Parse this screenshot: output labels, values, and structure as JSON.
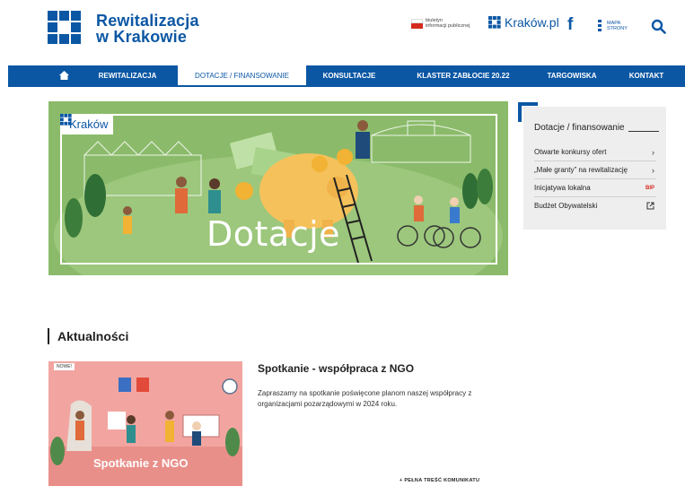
{
  "header": {
    "logo_line1": "Rewitalizacja",
    "logo_line2": "w Krakowie",
    "bip_line1": "biuletyn",
    "bip_line2": "informacji publicznej",
    "krakow_pl": "Kraków.pl",
    "facebook": "f",
    "map_line1": "MAPA",
    "map_line2": "STRONY",
    "icons": [
      "krakow-logo-icon",
      "facebook-icon",
      "sitemap-icon",
      "search-icon"
    ]
  },
  "nav": {
    "items": [
      {
        "label": "REWITALIZACJA"
      },
      {
        "label": "DOTACJE / FINANSOWANIE"
      },
      {
        "label": "KONSULTACJE"
      },
      {
        "label": "KLASTER ZABŁOCIE 20.22"
      },
      {
        "label": "TARGOWISKA"
      },
      {
        "label": "KONTAKT"
      }
    ],
    "active": "DOTACJE / FINANSOWANIE"
  },
  "banner": {
    "brand": "Kraków",
    "title": "Dotacje"
  },
  "sidebar": {
    "title": "Dotacje / finansowanie",
    "items": [
      {
        "label": "Otwarte konkursy ofert"
      },
      {
        "label": "„Małe granty” na rewitalizację"
      },
      {
        "label": "Inicjatywa lokalna",
        "badge": "BIP"
      },
      {
        "label": "Budżet Obywatelski"
      }
    ]
  },
  "news": {
    "section_title": "Aktualności",
    "items": [
      {
        "badge": "NOWE!",
        "image_label": "Spotkanie z NGO",
        "title": "Spotkanie - współpraca z NGO",
        "lead": "Zapraszamy na spotkanie poświęcone planom naszej współpracy z organizacjami pozarządowymi w 2024 roku.",
        "more": "+ PEŁNA TREŚĆ KOMUNIKATU"
      }
    ]
  },
  "colors": {
    "brand_blue": "#0b57a4",
    "banner_green": "#8bbb6a",
    "sidebar_bg": "#eeeeee",
    "news_image_pink": "#f2a5a0"
  }
}
